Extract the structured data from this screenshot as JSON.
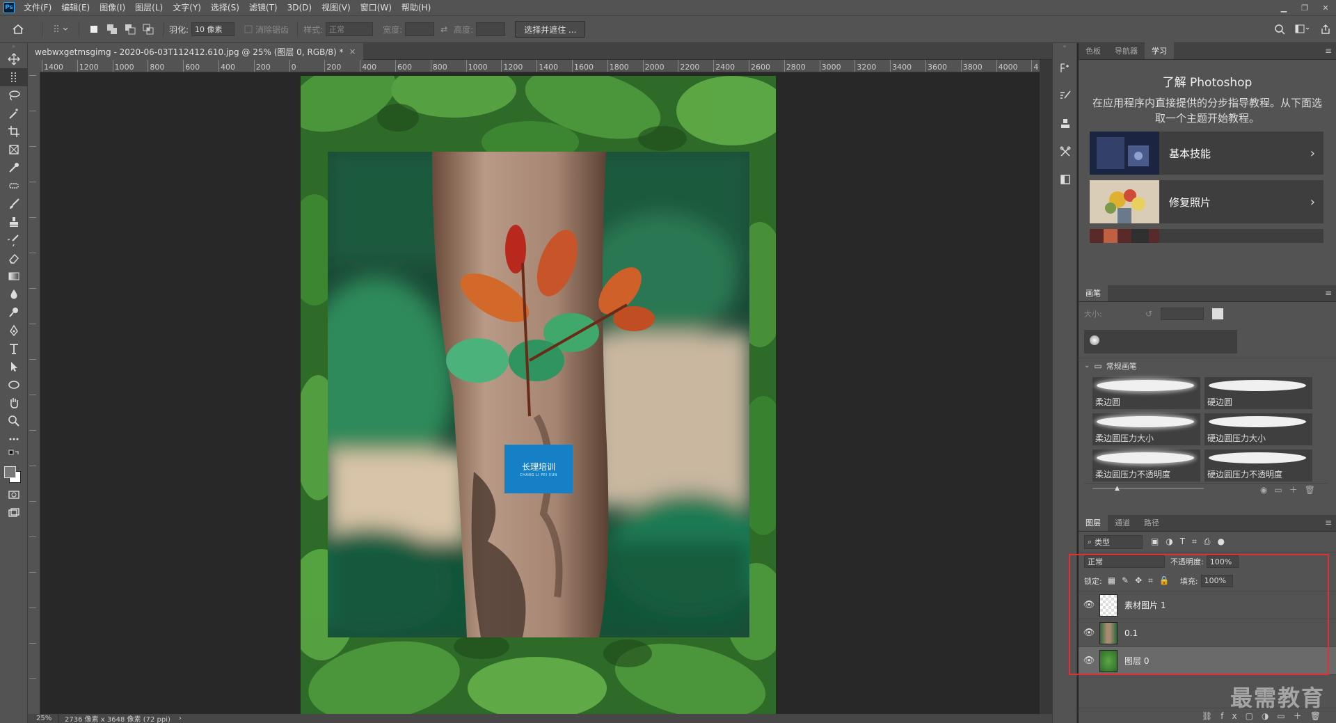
{
  "app": {
    "logo": "Ps"
  },
  "menu": [
    "文件(F)",
    "编辑(E)",
    "图像(I)",
    "图层(L)",
    "文字(Y)",
    "选择(S)",
    "滤镜(T)",
    "3D(D)",
    "视图(V)",
    "窗口(W)",
    "帮助(H)"
  ],
  "options": {
    "feather_label": "羽化:",
    "feather_value": "10 像素",
    "antialias_label": "消除锯齿",
    "style_label": "样式:",
    "style_value": "正常",
    "width_label": "宽度:",
    "height_label": "高度:",
    "select_mask_button": "选择并遮住 ..."
  },
  "document": {
    "tab_title": "webwxgetmsgimg - 2020-06-03T112412.610.jpg @ 25% (图层 0, RGB/8) *",
    "close": "×",
    "ruler_labels": [
      "1400",
      "1200",
      "1000",
      "800",
      "600",
      "400",
      "200",
      "0",
      "200",
      "400",
      "600",
      "800",
      "1000",
      "1200",
      "1400",
      "1600",
      "1800",
      "2000",
      "2200",
      "2400",
      "2600",
      "2800",
      "3000",
      "3200",
      "3400",
      "3600",
      "3800",
      "4000",
      "4"
    ],
    "logo_text_cn": "长理培训",
    "logo_text_en": "CHANG LI PEI XUN"
  },
  "status": {
    "zoom": "25%",
    "info": "2736 像素 x 3648 像素 (72 ppi)",
    "arrow": "›"
  },
  "learn_panel": {
    "tabs": [
      "色板",
      "导航器",
      "学习"
    ],
    "title": "了解 Photoshop",
    "description": "在应用程序内直接提供的分步指导教程。从下面选取一个主题开始教程。",
    "cards": [
      {
        "label": "基本技能"
      },
      {
        "label": "修复照片"
      }
    ]
  },
  "brush_panel": {
    "tab": "画笔",
    "size_label": "大小:",
    "folder": "常规画笔",
    "brushes": [
      "柔边圆",
      "硬边圆",
      "柔边圆压力大小",
      "硬边圆压力大小",
      "柔边圆压力不透明度",
      "硬边圆压力不透明度"
    ]
  },
  "layers_panel": {
    "tabs": [
      "图层",
      "通道",
      "路径"
    ],
    "filter_value": "类型",
    "blend_mode": "正常",
    "opacity_label": "不透明度:",
    "opacity_value": "100%",
    "lock_label": "锁定:",
    "fill_label": "填充:",
    "fill_value": "100%",
    "layers": [
      {
        "name": "素材图片 1",
        "visible": true,
        "selected": false
      },
      {
        "name": "0.1",
        "visible": true,
        "selected": false
      },
      {
        "name": "图层 0",
        "visible": true,
        "selected": true
      }
    ]
  },
  "watermark": "最需教育",
  "colors": {
    "accent_highlight": "#e03030",
    "logo_blue": "#1580c6",
    "ui_bg": "#535353",
    "canvas_bg": "#282828"
  }
}
